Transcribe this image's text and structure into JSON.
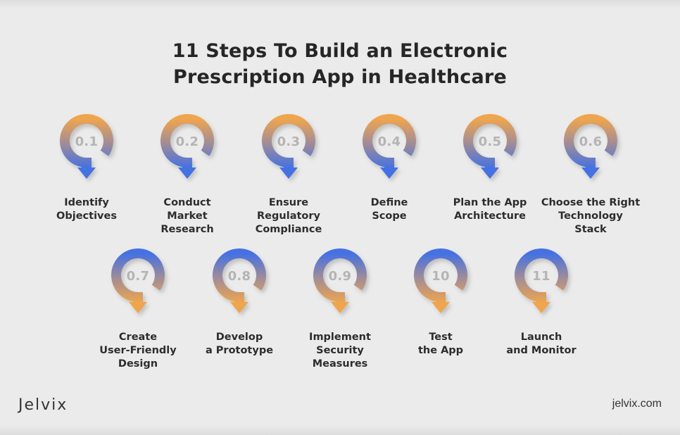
{
  "title_line1": "11 Steps To Build an Electronic",
  "title_line2": "Prescription App in Healthcare",
  "colors": {
    "orange": "#EFA54E",
    "blue": "#4471E2",
    "background": "#EBEBEB",
    "number": "#B4B4B4"
  },
  "steps": [
    {
      "number": "0.1",
      "label": "Identify\nObjectives",
      "gradient": "orange-to-blue"
    },
    {
      "number": "0.2",
      "label": "Conduct\nMarket\nResearch",
      "gradient": "orange-to-blue"
    },
    {
      "number": "0.3",
      "label": "Ensure\nRegulatory\nCompliance",
      "gradient": "orange-to-blue"
    },
    {
      "number": "0.4",
      "label": "Define\nScope",
      "gradient": "orange-to-blue"
    },
    {
      "number": "0.5",
      "label": "Plan the App\nArchitecture",
      "gradient": "orange-to-blue"
    },
    {
      "number": "0.6",
      "label": "Choose the Right\nTechnology\nStack",
      "gradient": "orange-to-blue"
    },
    {
      "number": "0.7",
      "label": "Create\nUser-Friendly\nDesign",
      "gradient": "blue-to-orange"
    },
    {
      "number": "0.8",
      "label": "Develop\na Prototype",
      "gradient": "blue-to-orange"
    },
    {
      "number": "0.9",
      "label": "Implement\nSecurity\nMeasures",
      "gradient": "blue-to-orange"
    },
    {
      "number": "10",
      "label": "Test\nthe App",
      "gradient": "blue-to-orange"
    },
    {
      "number": "11",
      "label": "Launch\nand Monitor",
      "gradient": "blue-to-orange"
    }
  ],
  "footer": {
    "logo": "Jelvix",
    "site": "jelvix.com"
  }
}
